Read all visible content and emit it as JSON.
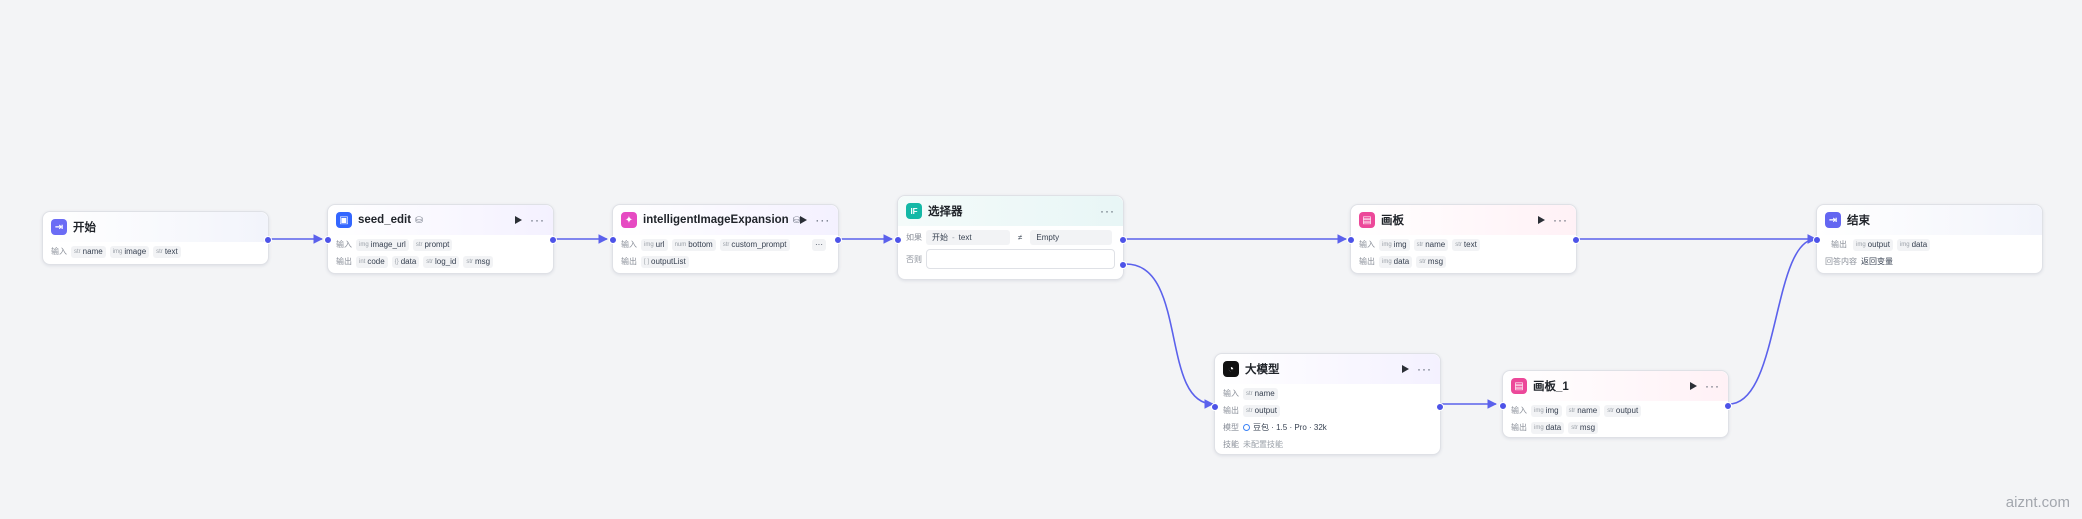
{
  "colors": {
    "accent": "#4d53e8",
    "edge": "#5b61ec",
    "start_icon": "#6b6cf5",
    "seed_icon": "#3366ff",
    "plugin_icon": "#e64ac2",
    "selector_icon": "#14b8a6",
    "board_icon": "#ec4899",
    "llm_icon": "#111111",
    "end_icon": "#6366f1"
  },
  "nodes": {
    "start": {
      "title": "开始",
      "icon": "start-icon",
      "input_label": "输入",
      "inputs": [
        {
          "type": "str",
          "name": "name"
        },
        {
          "type": "img",
          "name": "image"
        },
        {
          "type": "str",
          "name": "text"
        }
      ]
    },
    "seed_edit": {
      "title": "seed_edit",
      "icon": "image-edit-icon",
      "badge_icon": "plugin-badge-icon",
      "input_label": "输入",
      "output_label": "输出",
      "inputs": [
        {
          "type": "img",
          "name": "image_url"
        },
        {
          "type": "str",
          "name": "prompt"
        }
      ],
      "outputs": [
        {
          "type": "int",
          "name": "code"
        },
        {
          "type": "{}",
          "name": "data"
        },
        {
          "type": "str",
          "name": "log_id"
        },
        {
          "type": "str",
          "name": "msg"
        }
      ]
    },
    "expansion": {
      "title": "intelligentImageExpansion",
      "icon": "plugin-icon",
      "badge_icon": "plugin-badge-icon",
      "input_label": "输入",
      "output_label": "输出",
      "inputs": [
        {
          "type": "img",
          "name": "url"
        },
        {
          "type": "num",
          "name": "bottom"
        },
        {
          "type": "str",
          "name": "custom_prompt"
        }
      ],
      "outputs": [
        {
          "type": "[ ]",
          "name": "outputList"
        }
      ]
    },
    "selector": {
      "title": "选择器",
      "icon": "if-icon",
      "icon_text": "IF",
      "if_label": "如果",
      "else_label": "否则",
      "cond_source": "开始",
      "cond_var": "text",
      "cond_op": "≠",
      "cond_value": "Empty"
    },
    "board": {
      "title": "画板",
      "icon": "board-icon",
      "input_label": "输入",
      "output_label": "输出",
      "inputs": [
        {
          "type": "img",
          "name": "img"
        },
        {
          "type": "str",
          "name": "name"
        },
        {
          "type": "str",
          "name": "text"
        }
      ],
      "outputs": [
        {
          "type": "img",
          "name": "data"
        },
        {
          "type": "str",
          "name": "msg"
        }
      ]
    },
    "llm": {
      "title": "大模型",
      "icon": "llm-icon",
      "input_label": "输入",
      "output_label": "输出",
      "model_label": "模型",
      "skill_label": "技能",
      "inputs": [
        {
          "type": "str",
          "name": "name"
        }
      ],
      "outputs": [
        {
          "type": "str",
          "name": "output"
        }
      ],
      "model": "豆包 · 1.5 · Pro · 32k",
      "skill": "未配置技能"
    },
    "board1": {
      "title": "画板_1",
      "icon": "board-icon",
      "input_label": "输入",
      "output_label": "输出",
      "inputs": [
        {
          "type": "img",
          "name": "img"
        },
        {
          "type": "str",
          "name": "name"
        },
        {
          "type": "str",
          "name": "output"
        }
      ],
      "outputs": [
        {
          "type": "img",
          "name": "data"
        },
        {
          "type": "str",
          "name": "msg"
        }
      ]
    },
    "end": {
      "title": "结束",
      "icon": "end-icon",
      "output_label": "输出",
      "answer_label": "回答内容",
      "outputs": [
        {
          "type": "img",
          "name": "output"
        },
        {
          "type": "img",
          "name": "data"
        }
      ],
      "answer": "返回变量"
    }
  },
  "watermark": "aiznt.com"
}
